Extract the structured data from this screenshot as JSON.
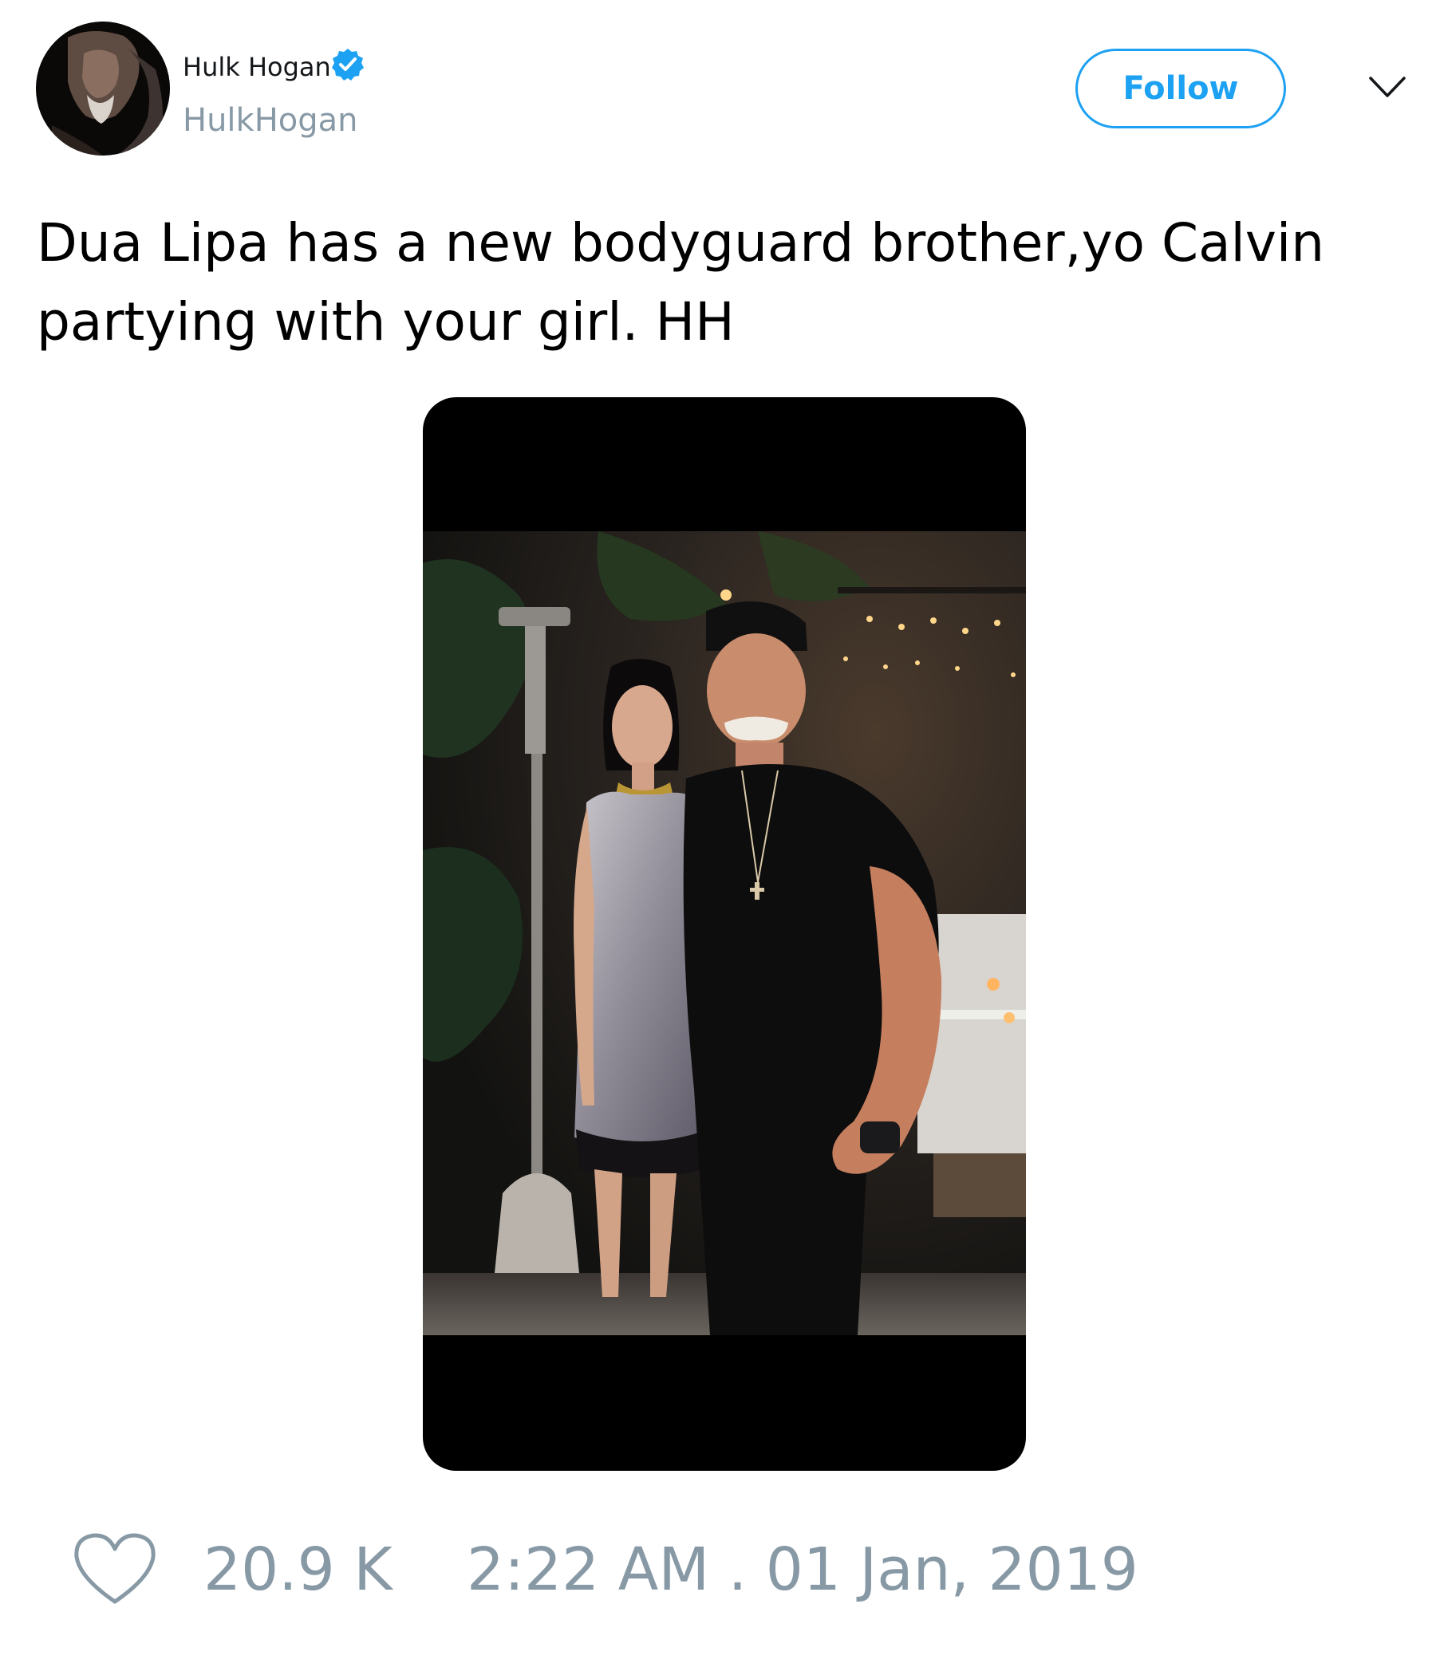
{
  "author": {
    "display_name": "Hulk Hogan",
    "handle": "HulkHogan",
    "verified": true,
    "avatar_icon": "profile-avatar"
  },
  "header": {
    "follow_label": "Follow",
    "menu_icon": "chevron-down-icon"
  },
  "tweet": {
    "text": "Dua Lipa has a new bodyguard brother,yo Calvin partying with your girl. HH"
  },
  "media": {
    "type": "photo",
    "background": "#000000"
  },
  "footer": {
    "like_count": "20.9 K",
    "timestamp": "2:22 AM . 01 Jan, 2019",
    "heart_icon": "heart-outline-icon"
  },
  "colors": {
    "accent": "#1da1f2",
    "muted": "#8899a6",
    "text": "#000000"
  }
}
